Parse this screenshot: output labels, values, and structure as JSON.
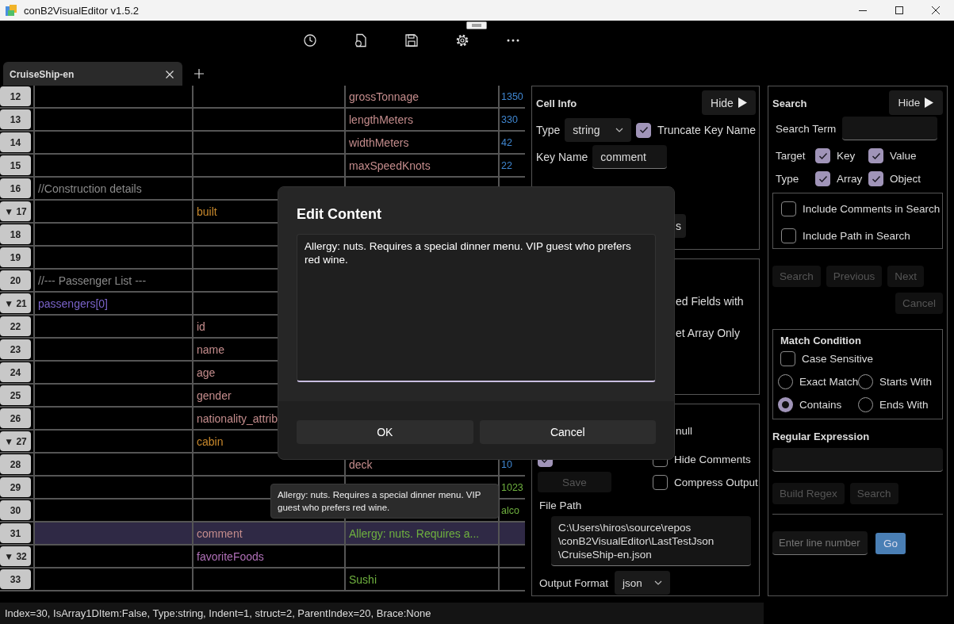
{
  "window": {
    "title": "conB2VisualEditor v1.5.2"
  },
  "toolbar": {
    "buttons": [
      {
        "kind": "clock"
      },
      {
        "kind": "file"
      },
      {
        "kind": "save"
      },
      {
        "kind": "gear"
      },
      {
        "kind": "more"
      }
    ]
  },
  "tabs": [
    {
      "label": "CruiseShip-en",
      "selected": true
    }
  ],
  "grid": {
    "rows": [
      {
        "num": "12",
        "selected": false,
        "cells": [
          {},
          {},
          {
            "text": "grossTonnage",
            "kind": "key"
          },
          {
            "text": "1350",
            "kind": "number"
          }
        ]
      },
      {
        "num": "13",
        "selected": false,
        "cells": [
          {},
          {},
          {
            "text": "lengthMeters",
            "kind": "key"
          },
          {
            "text": "330",
            "kind": "number"
          }
        ]
      },
      {
        "num": "14",
        "selected": false,
        "cells": [
          {},
          {},
          {
            "text": "widthMeters",
            "kind": "key"
          },
          {
            "text": "42",
            "kind": "number"
          }
        ]
      },
      {
        "num": "15",
        "selected": false,
        "cells": [
          {},
          {},
          {
            "text": "maxSpeedKnots",
            "kind": "key"
          },
          {
            "text": "22",
            "kind": "number"
          }
        ]
      },
      {
        "num": "16",
        "selected": false,
        "cells": [
          {
            "text": "//Construction details",
            "kind": "comment"
          },
          {},
          {},
          {}
        ]
      },
      {
        "num": "17",
        "toggle": "▼",
        "selected": false,
        "cells": [
          {},
          {
            "text": "built",
            "kind": "object"
          },
          {},
          {}
        ]
      },
      {
        "num": "18",
        "selected": false,
        "cells": [
          {},
          {},
          {},
          {}
        ]
      },
      {
        "num": "19",
        "selected": false,
        "cells": [
          {},
          {},
          {},
          {}
        ]
      },
      {
        "num": "20",
        "selected": false,
        "cells": [
          {
            "text": "//--- Passenger List ---",
            "kind": "comment"
          },
          {},
          {},
          {}
        ]
      },
      {
        "num": "21",
        "toggle": "▼",
        "selected": false,
        "cells": [
          {
            "text": "passengers[0]",
            "kind": "array"
          },
          {},
          {},
          {}
        ]
      },
      {
        "num": "22",
        "selected": false,
        "cells": [
          {},
          {
            "text": "id",
            "kind": "key"
          },
          {},
          {}
        ]
      },
      {
        "num": "23",
        "selected": false,
        "cells": [
          {},
          {
            "text": "name",
            "kind": "key"
          },
          {},
          {}
        ]
      },
      {
        "num": "24",
        "selected": false,
        "cells": [
          {},
          {
            "text": "age",
            "kind": "key"
          },
          {},
          {}
        ]
      },
      {
        "num": "25",
        "selected": false,
        "cells": [
          {},
          {
            "text": "gender",
            "kind": "key"
          },
          {},
          {}
        ]
      },
      {
        "num": "26",
        "selected": false,
        "cells": [
          {},
          {
            "text": "nationality_attrib",
            "kind": "key"
          },
          {},
          {}
        ]
      },
      {
        "num": "27",
        "toggle": "▼",
        "selected": false,
        "cells": [
          {},
          {
            "text": "cabin",
            "kind": "object"
          },
          {},
          {}
        ]
      },
      {
        "num": "28",
        "selected": false,
        "cells": [
          {},
          {},
          {
            "text": "deck",
            "kind": "key"
          },
          {
            "text": "10",
            "kind": "number"
          }
        ]
      },
      {
        "num": "29",
        "selected": false,
        "cells": [
          {},
          {},
          {},
          {
            "text": "1023",
            "kind": "string"
          }
        ]
      },
      {
        "num": "30",
        "selected": false,
        "cells": [
          {},
          {},
          {},
          {
            "text": "alco",
            "kind": "string"
          }
        ]
      },
      {
        "num": "31",
        "selected": true,
        "cells": [
          {},
          {
            "text": "comment",
            "kind": "key"
          },
          {
            "text": "Allergy: nuts. Requires a...",
            "kind": "string"
          },
          {}
        ]
      },
      {
        "num": "32",
        "toggle": "▼",
        "selected": false,
        "cells": [
          {},
          {
            "text": "favoriteFoods",
            "kind": "arraykey"
          },
          {},
          {}
        ]
      },
      {
        "num": "33",
        "selected": false,
        "cells": [
          {},
          {},
          {
            "text": "Sushi",
            "kind": "string"
          },
          {}
        ]
      }
    ]
  },
  "cell_info": {
    "title": "Cell Info",
    "hide_label": "Hide",
    "type_label": "Type",
    "type_value": "string",
    "truncate": {
      "label": "Truncate Key Name",
      "checked": true
    },
    "key_name_label": "Key Name",
    "key_name": "comment",
    "fragment_button": "s"
  },
  "options_panel": {
    "fragments": [
      "ed Fields with",
      "et Array Only"
    ]
  },
  "output_panel": {
    "fragment": "null",
    "checkboxes": [
      {
        "checked": true
      },
      {
        "label": "Hide Comments",
        "checked": false
      },
      {
        "label": "Compress Output",
        "checked": false
      }
    ],
    "save_button": {
      "label": "Save",
      "disabled": true
    },
    "file_path_label": "File Path",
    "file_path": [
      "C:\\Users\\hiros\\source\\repos",
      "\\conB2VisualEditor\\LastTestJson",
      "\\CruiseShip-en.json"
    ],
    "output_format_label": "Output Format",
    "output_format": "json"
  },
  "search_panel": {
    "title": "Search",
    "hide_label": "Hide",
    "term_label": "Search Term",
    "target_label": "Target",
    "targets": [
      {
        "label": "Key",
        "checked": true
      },
      {
        "label": "Value",
        "checked": true
      }
    ],
    "type_label": "Type",
    "types": [
      {
        "label": "Array",
        "checked": true
      },
      {
        "label": "Object",
        "checked": true
      }
    ],
    "include": [
      {
        "label": "Include Comments in Search",
        "checked": false
      },
      {
        "label": "Include Path in Search",
        "checked": false
      }
    ],
    "buttons": [
      {
        "label": "Search",
        "disabled": true
      },
      {
        "label": "Previous",
        "disabled": true
      },
      {
        "label": "Next",
        "disabled": true
      }
    ],
    "cancel": {
      "label": "Cancel",
      "disabled": true
    },
    "match": {
      "title": "Match Condition",
      "case": {
        "label": "Case Sensitive",
        "checked": false
      },
      "options": [
        {
          "label": "Exact Match",
          "selected": false
        },
        {
          "label": "Starts With",
          "selected": false
        },
        {
          "label": "Contains",
          "selected": true
        },
        {
          "label": "Ends With",
          "selected": false
        }
      ]
    },
    "regex": {
      "title": "Regular Expression",
      "buttons": [
        {
          "label": "Build Regex",
          "disabled": true
        },
        {
          "label": "Search",
          "disabled": true
        }
      ]
    },
    "goto": {
      "placeholder": "Enter line number",
      "button": "Go"
    }
  },
  "dialog": {
    "title": "Edit Content",
    "value": "Allergy: nuts. Requires a special dinner menu. VIP guest who prefers red wine.",
    "buttons": [
      "OK",
      "Cancel"
    ]
  },
  "tooltip": {
    "text": "Allergy: nuts. Requires a special dinner menu. VIP guest who prefers red wine."
  },
  "status_bar": {
    "text": "Index=30, IsArray1DItem:False, Type:string, Indent=1, struct=2, ParentIndex=20, Brace:None"
  }
}
